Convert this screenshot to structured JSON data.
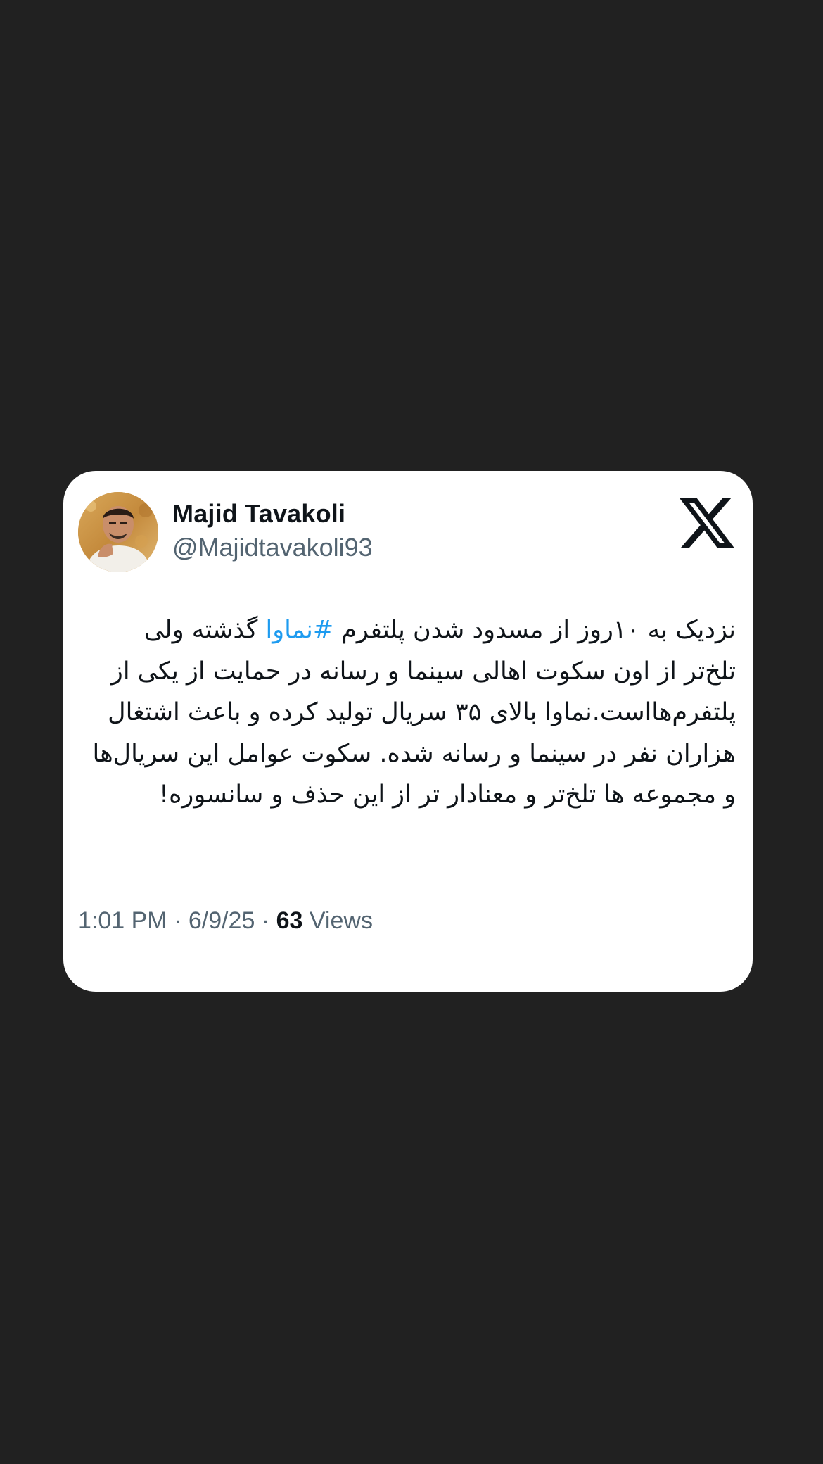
{
  "tweet": {
    "display_name": "Majid Tavakoli",
    "handle": "@Majidtavakoli93",
    "text_part1": "نزدیک به ۱۰روز از مسدود شدن پلتفرم ",
    "hashtag": "#نماوا",
    "text_part2": " گذشته ولی تلخ‌تر از اون سکوت اهالی سینما و رسانه در حمایت از یکی از پلتفرم‌هااست.نماوا بالای ۳۵ سریال تولید کرده و باعث اشتغال هزاران نفر در سینما و رسانه شده. سکوت عوامل این سریال‌ها و مجموعه ها تلخ‌تر و معنادار تر از این حذف و سانسوره!",
    "time": "1:01 PM",
    "separator1": " · ",
    "date": "6/9/25",
    "separator2": " · ",
    "views_count": "63",
    "views_label": " Views"
  },
  "icons": {
    "avatar": "profile-photo",
    "logo": "x-logo"
  },
  "colors": {
    "background": "#212121",
    "card": "#ffffff",
    "text": "#0f1419",
    "secondary": "#536471",
    "hashtag": "#1d9bf0"
  }
}
